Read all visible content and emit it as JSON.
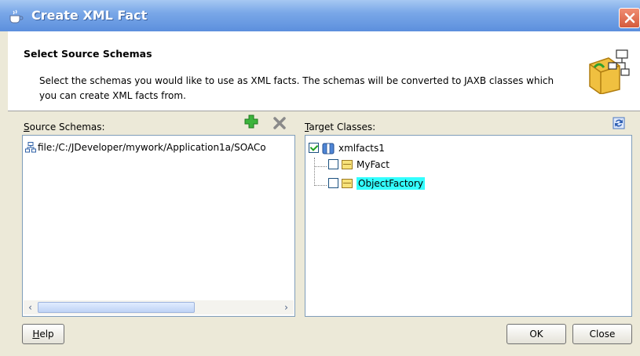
{
  "window": {
    "title": "Create XML Fact"
  },
  "header": {
    "title": "Select Source Schemas",
    "description": "Select the schemas you would like to use as XML facts. The schemas will be converted to JAXB classes which you can create XML facts from."
  },
  "source_schemas": {
    "label_accel": "S",
    "label_rest": "ource Schemas:",
    "items": [
      {
        "icon": "schema-icon",
        "path": "file:/C:/JDeveloper/mywork/Application1a/SOACo"
      }
    ]
  },
  "target_classes": {
    "label_accel": "T",
    "label_rest": "arget Classes:",
    "root": {
      "label": "xmlfacts1",
      "checked": true,
      "icon": "package-icon"
    },
    "children": [
      {
        "label": "MyFact",
        "checked": false,
        "icon": "class-icon"
      },
      {
        "label": "ObjectFactory",
        "checked": false,
        "icon": "class-icon",
        "selected": true
      }
    ]
  },
  "buttons": {
    "help_accel": "H",
    "help_rest": "elp",
    "ok": "OK",
    "close": "Close"
  },
  "colors": {
    "titlebar": "#7aa8e8",
    "selection": "#33ffff",
    "dialog_bg": "#ece9d8",
    "add_icon": "#2ea02e"
  }
}
